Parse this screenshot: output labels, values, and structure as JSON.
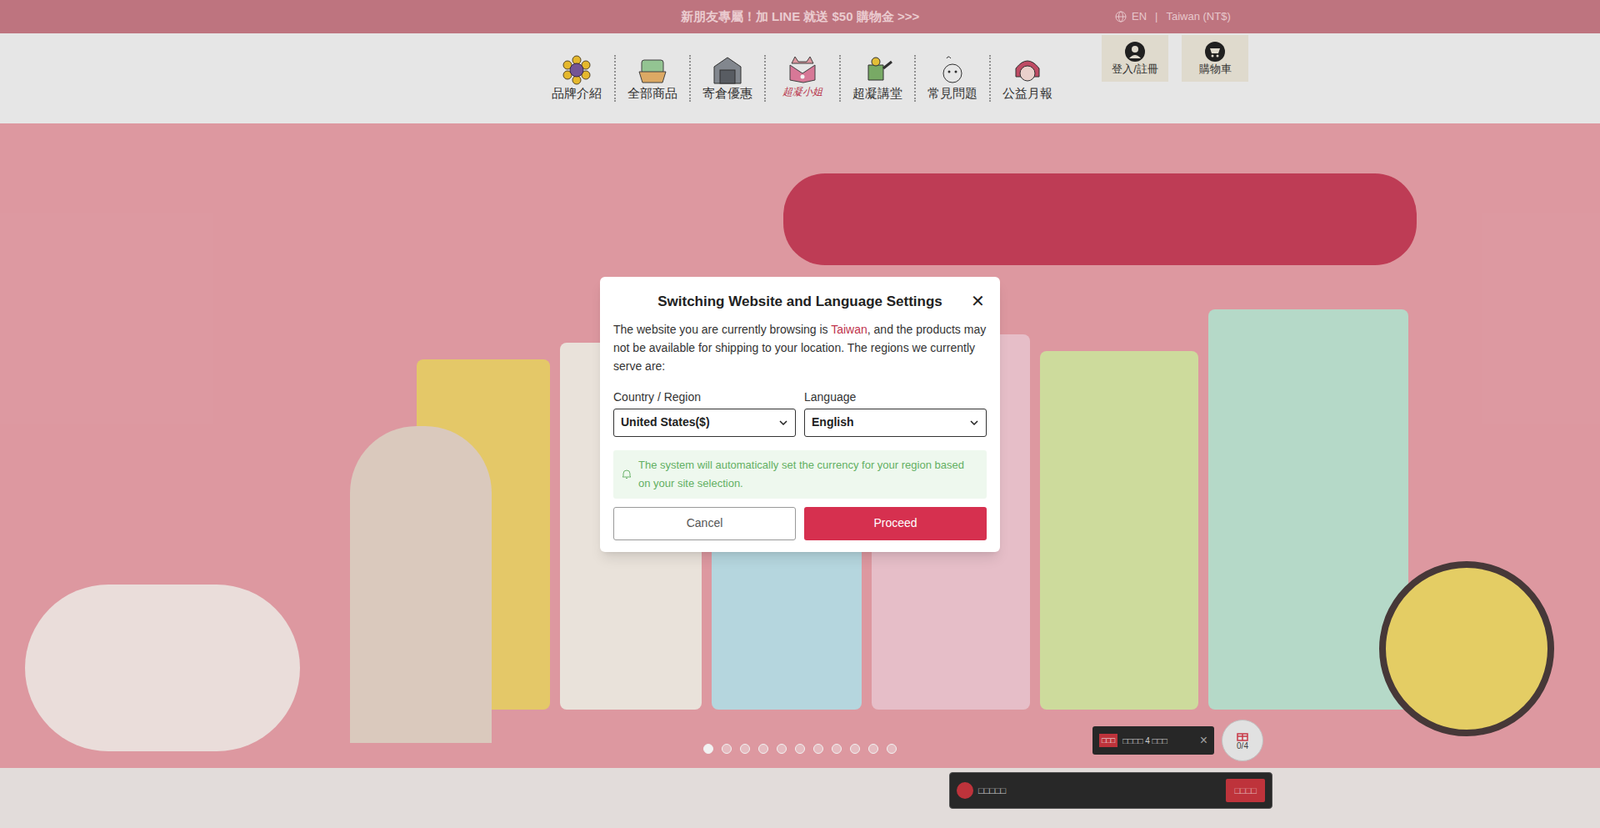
{
  "announcement": {
    "text": "新朋友專屬！加 LINE 就送 $50 購物金 >>>",
    "language": "EN",
    "separator": "|",
    "region": "Taiwan (NT$)"
  },
  "nav_left": [
    {
      "label": "品牌介紹"
    },
    {
      "label": "全部商品"
    },
    {
      "label": "寄倉優惠"
    }
  ],
  "logo": {
    "text": "超凝小姐"
  },
  "nav_right": [
    {
      "label": "超凝講堂"
    },
    {
      "label": "常見問題"
    },
    {
      "label": "公益月報"
    }
  ],
  "account": {
    "login": "登入/註冊",
    "cart": "購物車"
  },
  "carousel": {
    "dots": [
      {
        "selected": true
      },
      {
        "selected": false
      },
      {
        "selected": false
      },
      {
        "selected": false
      },
      {
        "selected": false
      },
      {
        "selected": false
      },
      {
        "selected": false
      },
      {
        "selected": false
      },
      {
        "selected": false
      },
      {
        "selected": false
      },
      {
        "selected": false
      }
    ]
  },
  "reward_tooltip": {
    "badge": "□□□",
    "text": "□□□□ 4 □□□",
    "close": "×"
  },
  "gift_button": {
    "count": "0/4"
  },
  "bottom_bar": {
    "text": "□□□□□",
    "button": "□□□□"
  },
  "modal": {
    "title": "Switching Website and Language Settings",
    "close": "✕",
    "body_before": "The website you are currently browsing is ",
    "body_region": "Taiwan",
    "body_after": ", and the products may not be available for shipping to your location. The regions we currently serve are:",
    "country_label": "Country / Region",
    "country_value": "United States($)",
    "language_label": "Language",
    "language_value": "English",
    "notice": "The system will automatically set the currency for your region based on your site selection.",
    "cancel": "Cancel",
    "proceed": "Proceed"
  }
}
